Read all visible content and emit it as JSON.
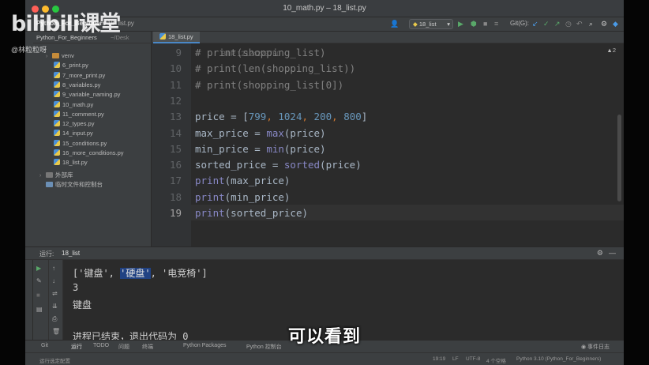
{
  "window": {
    "title": "10_math.py – 18_list.py"
  },
  "toolbar": {
    "project_name": "Python_For_Beginners",
    "project_path": "~/Desk",
    "breadcrumb_file": "18_list.py",
    "run_config": "18_list",
    "git_label": "Git(G):"
  },
  "project_tree": {
    "items": [
      {
        "label": "venv",
        "type": "folder"
      },
      {
        "label": "6_print.py",
        "type": "file"
      },
      {
        "label": "7_more_print.py",
        "type": "file"
      },
      {
        "label": "8_variables.py",
        "type": "file"
      },
      {
        "label": "9_variable_naming.py",
        "type": "file"
      },
      {
        "label": "10_math.py",
        "type": "file"
      },
      {
        "label": "11_comment.py",
        "type": "file"
      },
      {
        "label": "12_types.py",
        "type": "file"
      },
      {
        "label": "14_input.py",
        "type": "file"
      },
      {
        "label": "15_conditions.py",
        "type": "file"
      },
      {
        "label": "16_more_conditions.py",
        "type": "file"
      },
      {
        "label": "18_list.py",
        "type": "file"
      }
    ],
    "external_libs": "外部库",
    "scratches": "临时文件和控制台"
  },
  "editor": {
    "tab_label": "18_list.py",
    "warnings": "▲2",
    "overlay": "BiliP 12124273760",
    "lines": [
      {
        "num": "9",
        "text": "# print(shopping_list)"
      },
      {
        "num": "10",
        "text": "# print(len(shopping_list))"
      },
      {
        "num": "11",
        "text": "# print(shopping_list[0])"
      },
      {
        "num": "12",
        "text": ""
      },
      {
        "num": "13",
        "text": "price = [799, 1024, 200, 800]"
      },
      {
        "num": "14",
        "text": "max_price = max(price)"
      },
      {
        "num": "15",
        "text": "min_price = min(price)"
      },
      {
        "num": "16",
        "text": "sorted_price = sorted(price)"
      },
      {
        "num": "17",
        "text": "print(max_price)"
      },
      {
        "num": "18",
        "text": "print(min_price)"
      },
      {
        "num": "19",
        "text": "print(sorted_price)"
      }
    ]
  },
  "run_panel": {
    "label": "运行:",
    "config": "18_list",
    "output": {
      "line1_parts": [
        "['键盘', ",
        "'硬盘'",
        ", '电竞椅']"
      ],
      "line2": "3",
      "line3": "键盘",
      "exit": "进程已结束，退出代码为 0"
    }
  },
  "bottom_tabs": [
    "Git",
    "运行",
    "TODO",
    "问题",
    "终端",
    "Python Packages",
    "Python 控制台"
  ],
  "event_log": "事件日志",
  "status": {
    "left": "运行选定配置",
    "position": "19:19",
    "line_sep": "LF",
    "encoding": "UTF-8",
    "indent": "4 个空格",
    "interpreter": "Python 3.10 (Python_For_Beginners)"
  },
  "watermark": {
    "logo": "bilibili课堂",
    "user": "@林粒粒呀"
  },
  "subtitle": "可以看到"
}
